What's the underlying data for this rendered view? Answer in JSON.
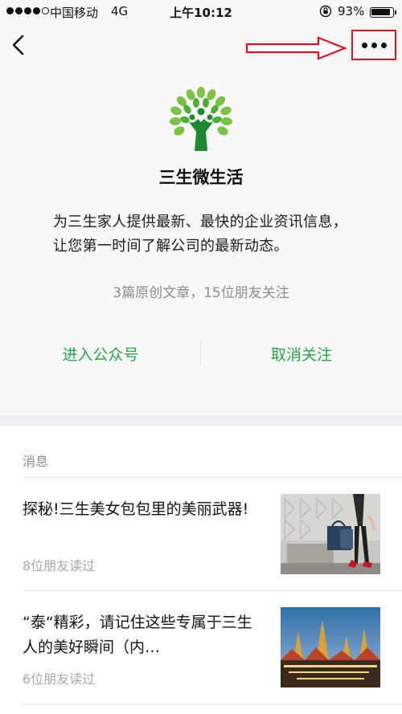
{
  "status_bar": {
    "carrier": "中国移动",
    "network": "4G",
    "time": "上午10:12",
    "battery": "93%"
  },
  "profile": {
    "name": "三生微生活",
    "description": "为三生家人提供最新、最快的企业资讯信息，让您第一时间了解公司的最新动态。",
    "stats": "3篇原创文章，15位朋友关注",
    "enter_label": "进入公众号",
    "unfollow_label": "取消关注"
  },
  "messages": {
    "header": "消息",
    "items": [
      {
        "title": "探秘!三生美女包包里的美丽武器!",
        "reads": "8位朋友读过"
      },
      {
        "title": "“泰“精彩，请记住这些专属于三生人的美好瞬间（内…",
        "reads": "6位朋友读过"
      }
    ]
  },
  "colors": {
    "accent": "#2aa546",
    "highlight": "#e0111e",
    "page_bg": "#f8f8f8"
  },
  "icons": {
    "back": "chevron-left-icon",
    "more": "more-dots-icon",
    "annotation": "red-arrow-icon",
    "logo": "green-tree-logo"
  }
}
